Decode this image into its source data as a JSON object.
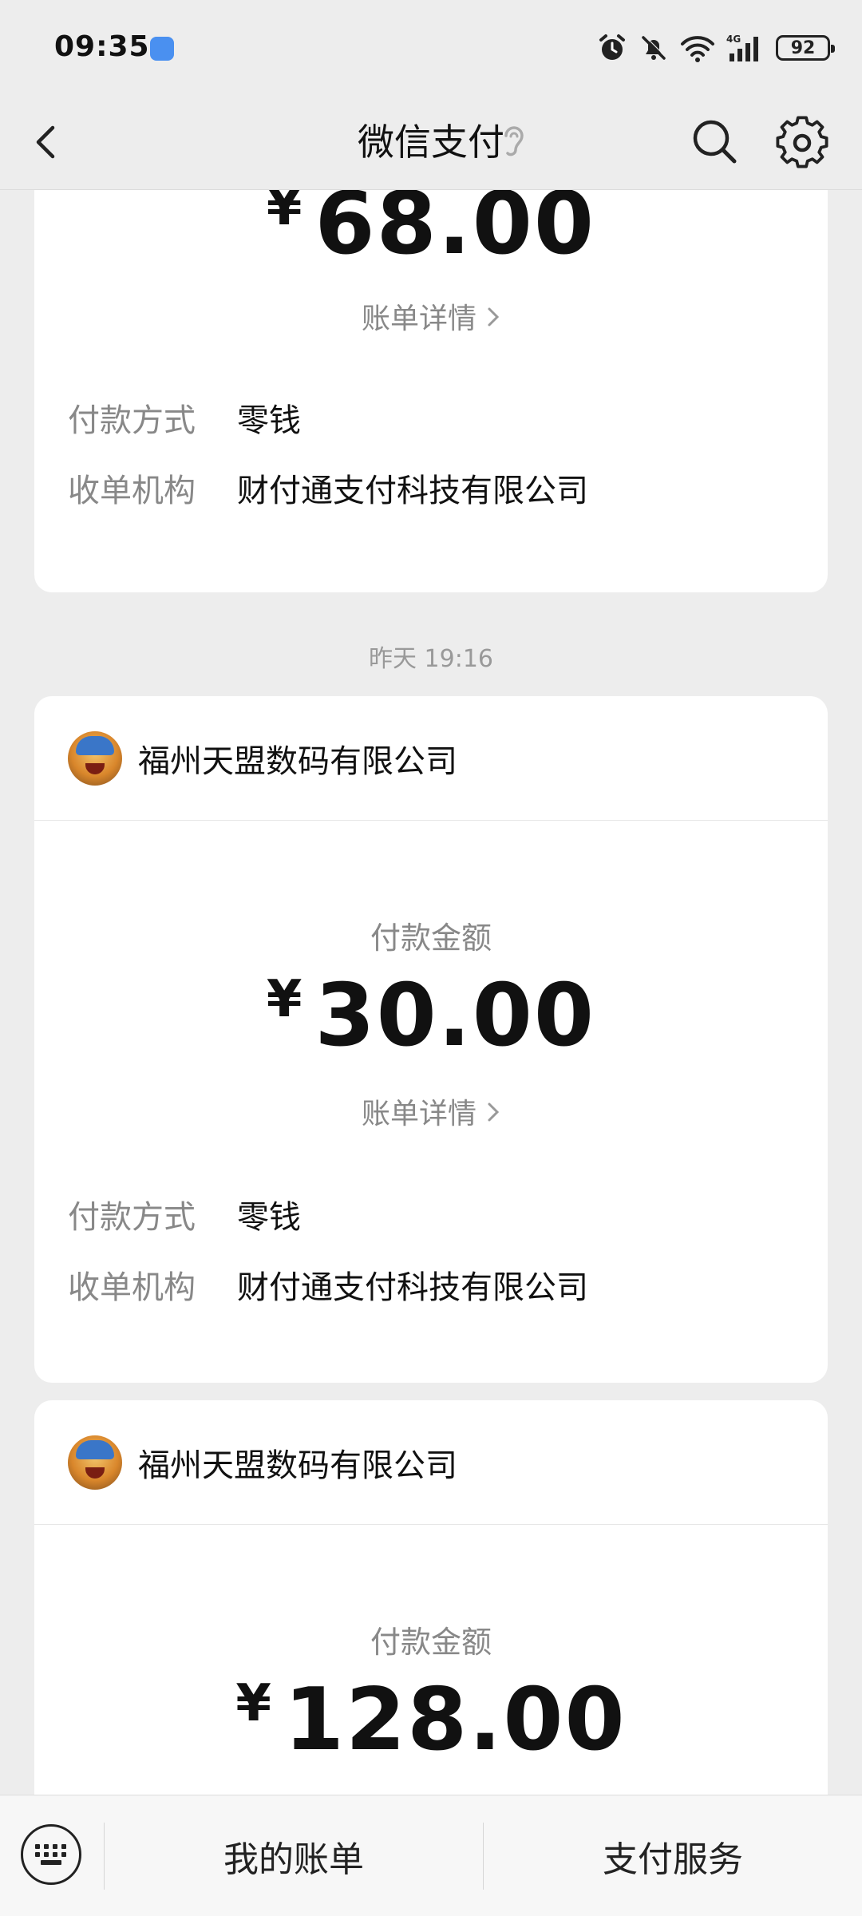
{
  "status": {
    "time": "09:35",
    "battery": "92",
    "network": "4G"
  },
  "nav": {
    "title": "微信支付"
  },
  "cards": [
    {
      "amount": "68.00",
      "currency": "¥",
      "detail_link": "账单详情",
      "rows": [
        {
          "key": "付款方式",
          "value": "零钱"
        },
        {
          "key": "收单机构",
          "value": "财付通支付科技有限公司"
        }
      ]
    },
    {
      "timestamp": "昨天 19:16",
      "merchant": "福州天盟数码有限公司",
      "amount_label": "付款金额",
      "currency": "¥",
      "amount": "30.00",
      "detail_link": "账单详情",
      "rows": [
        {
          "key": "付款方式",
          "value": "零钱"
        },
        {
          "key": "收单机构",
          "value": "财付通支付科技有限公司"
        }
      ]
    },
    {
      "merchant": "福州天盟数码有限公司",
      "amount_label": "付款金额",
      "currency": "¥",
      "amount": "128.00"
    }
  ],
  "bottom": {
    "my_bills": "我的账单",
    "pay_services": "支付服务"
  }
}
